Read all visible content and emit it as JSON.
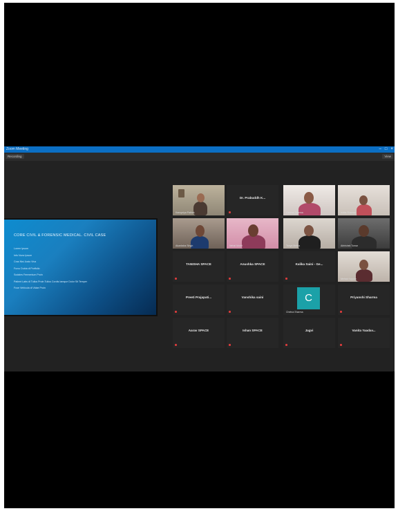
{
  "window": {
    "title": "Zoom Meeting",
    "left_button": "Recording",
    "right_button": "View"
  },
  "slide": {
    "title": "CORE CIVIL & FORENSIC MEDICAL. CIVIL CASE",
    "bullets": [
      "Lorem Ipsum",
      "Info Nunc Ipsum",
      "Cras Nisi Justo Viva",
      "Furcu Dubia di Portfolio",
      "Sodales Fermentum Proin",
      "Patient Labs di Tullus Proin Tullus Cordis Iamque Dolor Sit Temper",
      "Fuse Vehicula di Vidae Proin"
    ]
  },
  "participants": [
    {
      "kind": "video",
      "label": "Kanupriya Pathak"
    },
    {
      "kind": "name",
      "label": "Dr. Prabuddh K..."
    },
    {
      "kind": "video",
      "label": "Garima Sharma"
    },
    {
      "kind": "video",
      "label": "Ishita Sharma"
    },
    {
      "kind": "video",
      "label": "Akanksha Singh"
    },
    {
      "kind": "video",
      "label": "Nehal Mohit"
    },
    {
      "kind": "video",
      "label": "Tanya Mehta"
    },
    {
      "kind": "video",
      "label": "Abhishek Tomar"
    },
    {
      "kind": "name",
      "label": "TANISHA SPACE"
    },
    {
      "kind": "name",
      "label": "Anushka SPACE"
    },
    {
      "kind": "name",
      "label": "Kalika Saini - Ge..."
    },
    {
      "kind": "video",
      "label": "Mehak Kapoor"
    },
    {
      "kind": "name",
      "label": "Preeti Prajapati..."
    },
    {
      "kind": "name",
      "label": "Vanshika saini"
    },
    {
      "kind": "avatar",
      "letter": "C",
      "label": "Chetna Sharma"
    },
    {
      "kind": "name",
      "label": "Priyanshi Sharma"
    },
    {
      "kind": "name",
      "label": "Aarav SPACE"
    },
    {
      "kind": "name",
      "label": "Ishan SPACE"
    },
    {
      "kind": "name",
      "label": "Jagvi"
    },
    {
      "kind": "name",
      "label": "Vanita Yaadav..."
    }
  ]
}
